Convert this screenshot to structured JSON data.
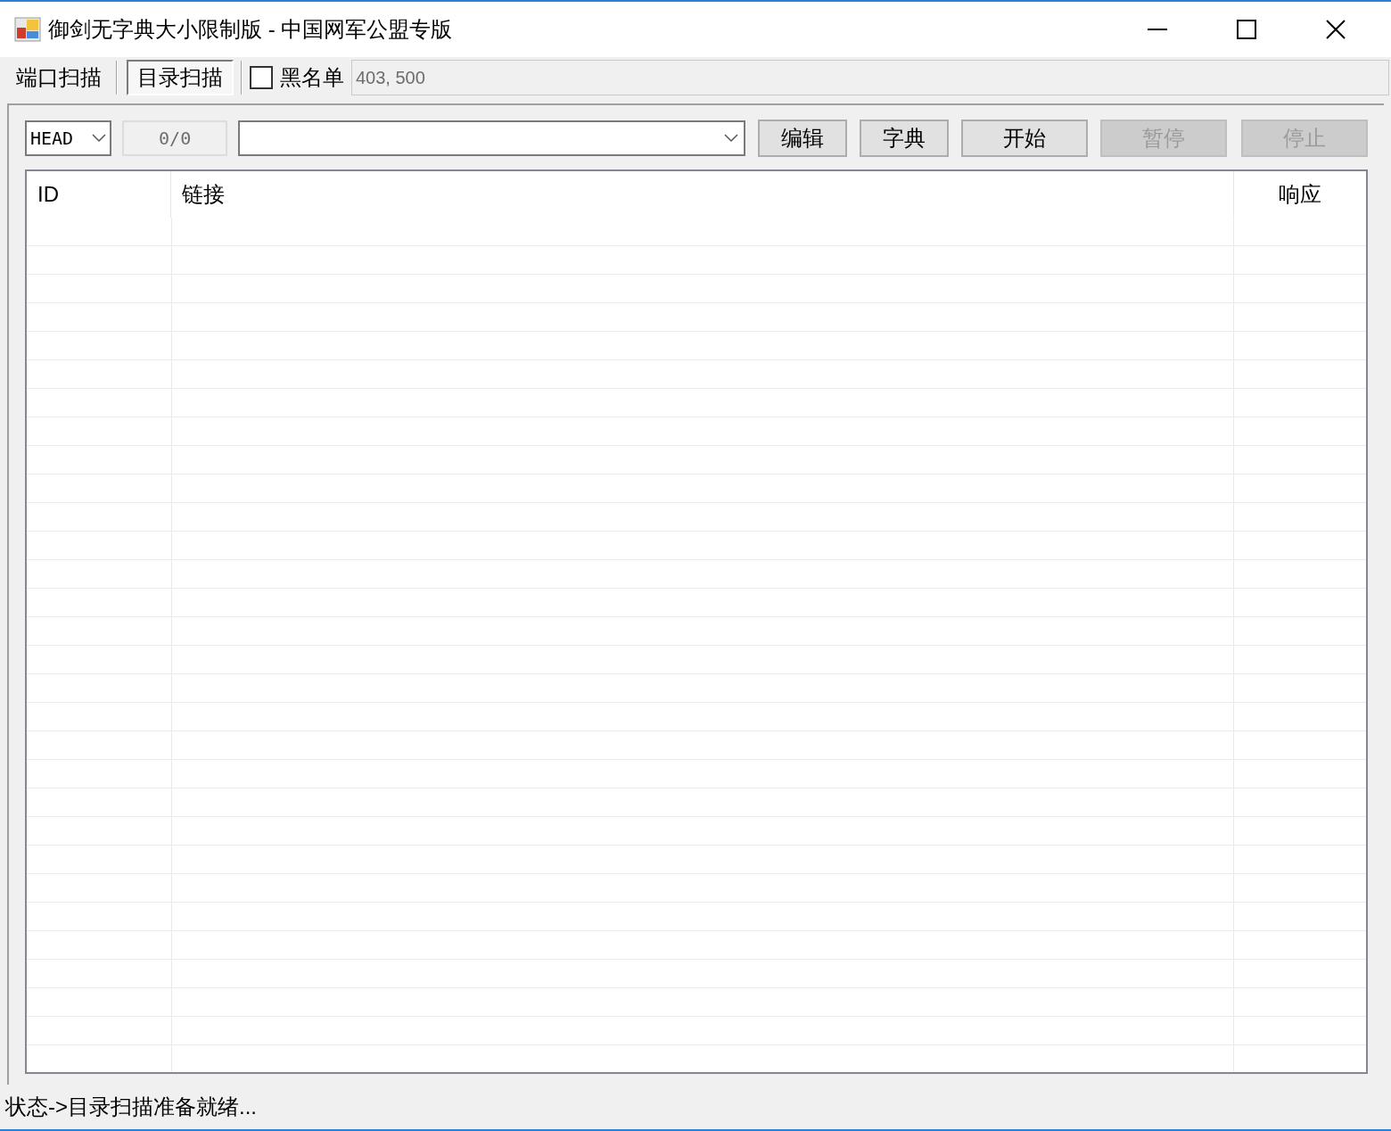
{
  "window": {
    "title": "御剑无字典大小限制版 - 中国网军公盟专版"
  },
  "tabs": [
    {
      "label": "端口扫描",
      "selected": false
    },
    {
      "label": "目录扫描",
      "selected": true
    }
  ],
  "blacklist": {
    "label": "黑名单",
    "checked": false,
    "value": "403, 500"
  },
  "controls": {
    "method": "HEAD",
    "progress": "0/0",
    "buttons": [
      {
        "label": "编辑",
        "disabled": false
      },
      {
        "label": "字典",
        "disabled": false
      },
      {
        "label": "开始",
        "disabled": false
      },
      {
        "label": "暂停",
        "disabled": true
      },
      {
        "label": "停止",
        "disabled": true
      }
    ]
  },
  "table": {
    "columns": [
      {
        "label": "ID"
      },
      {
        "label": "链接"
      },
      {
        "label": "响应"
      }
    ]
  },
  "status_bar": "状态->目录扫描准备就绪..."
}
